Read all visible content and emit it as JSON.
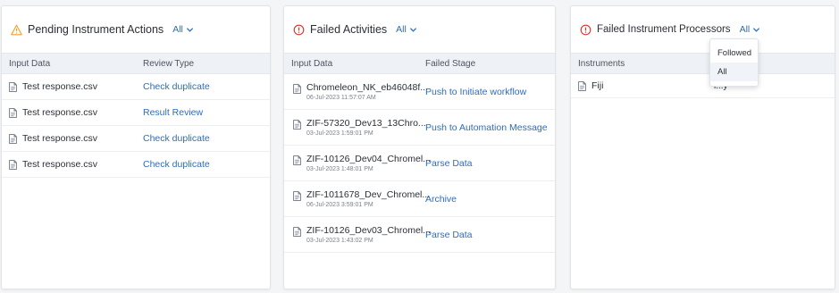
{
  "pending": {
    "title": "Pending Instrument Actions",
    "filter": "All",
    "columns": [
      "Input Data",
      "Review Type"
    ],
    "rows": [
      {
        "file": "Test response.csv",
        "review": "Check duplicate"
      },
      {
        "file": "Test response.csv",
        "review": "Result Review"
      },
      {
        "file": "Test response.csv",
        "review": "Check duplicate"
      },
      {
        "file": "Test response.csv",
        "review": "Check duplicate"
      }
    ]
  },
  "failed_activities": {
    "title": "Failed Activities",
    "filter": "All",
    "columns": [
      "Input Data",
      "Failed Stage"
    ],
    "rows": [
      {
        "file": "Chromeleon_NK_eb46048f...",
        "date": "06-Jul-2023 11:57:07 AM",
        "stage": "Push to Initiate workflow"
      },
      {
        "file": "ZIF-57320_Dev13_13Chro...",
        "date": "03-Jul-2023 1:59:01 PM",
        "stage": "Push to Automation Message"
      },
      {
        "file": "ZIF-10126_Dev04_Chromel...",
        "date": "03-Jul-2023 1:48:01 PM",
        "stage": "Parse Data"
      },
      {
        "file": "ZIF-1011678_Dev_Chromel...",
        "date": "06-Jul-2023 3:59:01 PM",
        "stage": "Archive"
      },
      {
        "file": "ZIF-10126_Dev03_Chromel...",
        "date": "03-Jul-2023 1:43:02 PM",
        "stage": "Parse Data"
      }
    ]
  },
  "failed_processors": {
    "title": "Failed Instrument Processors",
    "filter": "All",
    "columns": [
      "Instruments",
      ""
    ],
    "rows": [
      {
        "instrument": "Fiji",
        "partial": "l...y"
      }
    ],
    "dropdown_options": [
      "Followed",
      "All"
    ],
    "dropdown_selected": "All"
  },
  "colors": {
    "warning": "#f0a030",
    "error": "#d9342b",
    "link": "#2d6cc0"
  },
  "icons": {
    "pending_title": "warning-triangle-icon",
    "failed_title": "error-circle-icon",
    "file": "file-icon",
    "filter": "chevron-down-icon"
  }
}
